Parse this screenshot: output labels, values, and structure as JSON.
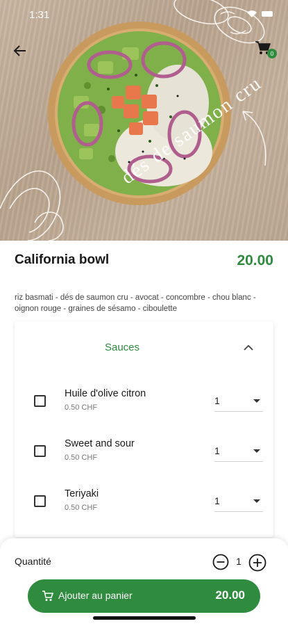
{
  "status_bar": {
    "time": "1:31"
  },
  "header": {
    "back_icon": "arrow-left-icon",
    "cart_icon": "cart-icon",
    "cart_count": "0"
  },
  "hero": {
    "caption": "dés de saumon cru"
  },
  "product": {
    "name": "California bowl",
    "price": "20.00",
    "description": "riz basmati - dés de saumon cru - avocat - concombre - chou blanc - oignon rouge - graines de sésamo - ciboulette"
  },
  "sauces": {
    "title": "Sauces",
    "items": [
      {
        "name": "Huile d'olive citron",
        "price": "0.50 CHF",
        "qty": "1"
      },
      {
        "name": "Sweet and sour",
        "price": "0.50 CHF",
        "qty": "1"
      },
      {
        "name": "Teriyaki",
        "price": "0.50 CHF",
        "qty": "1"
      }
    ]
  },
  "quantity": {
    "label": "Quantité",
    "value": "1"
  },
  "add_to_cart": {
    "label": "Ajouter au panier",
    "price": "20.00"
  },
  "colors": {
    "accent": "#2f8c3f",
    "background": "#ffffff"
  }
}
